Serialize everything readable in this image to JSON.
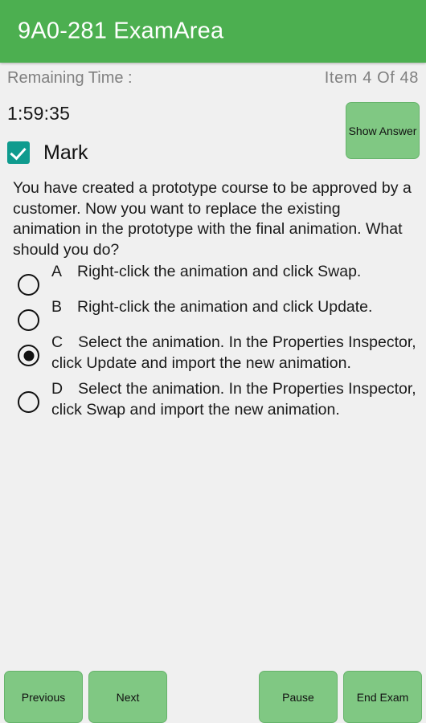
{
  "app": {
    "title": "9A0-281 ExamArea",
    "header_color": "#4CAF50",
    "background_color": "#F0F0F0",
    "button_color": "#80C883",
    "checkbox_color": "#0F9B8E"
  },
  "status": {
    "remaining_time_label": "Remaining Time :",
    "item_counter": "Item  4  Of  48",
    "timer_value": "1:59:35"
  },
  "controls": {
    "show_answer_label": "Show Answer",
    "mark_label": "Mark",
    "mark_checked": true
  },
  "question": {
    "text": "You have created a prototype course to be approved by a customer. Now you want to replace the existing animation in the prototype with the final animation. What should you do?",
    "selected_option": "C",
    "options": [
      {
        "letter": "A",
        "text": "Right-click the animation and click Swap.",
        "selected": false
      },
      {
        "letter": "B",
        "text": "Right-click the animation and click Update.",
        "selected": false
      },
      {
        "letter": "C",
        "text": "Select the animation. In the Properties Inspector, click Update and import the new animation.",
        "selected": true
      },
      {
        "letter": "D",
        "text": "Select the animation. In the Properties Inspector, click Swap and import the new animation.",
        "selected": false
      }
    ]
  },
  "bottom_bar": {
    "previous_label": "Previous",
    "next_label": "Next",
    "pause_label": "Pause",
    "end_exam_label": "End Exam"
  }
}
